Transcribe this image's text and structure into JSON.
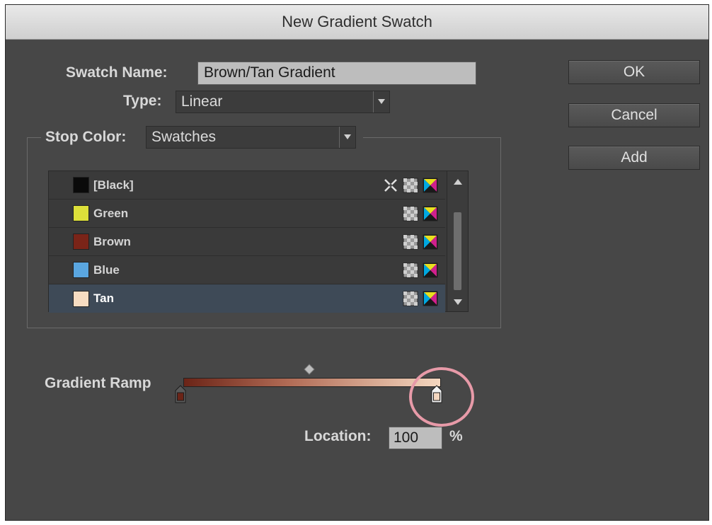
{
  "dialog": {
    "title": "New Gradient Swatch"
  },
  "form": {
    "swatch_name_label": "Swatch Name:",
    "swatch_name_value": "Brown/Tan Gradient",
    "type_label": "Type:",
    "type_value": "Linear",
    "stop_color_label": "Stop Color:",
    "stop_color_value": "Swatches"
  },
  "buttons": {
    "ok": "OK",
    "cancel": "Cancel",
    "add": "Add"
  },
  "swatches": [
    {
      "name": "[Black]",
      "color": "#0a0a0a",
      "registration_icon": true
    },
    {
      "name": "Green",
      "color": "#dde03a",
      "registration_icon": false
    },
    {
      "name": "Brown",
      "color": "#7a2418",
      "registration_icon": false
    },
    {
      "name": "Blue",
      "color": "#5aa6e0",
      "registration_icon": false
    },
    {
      "name": "Tan",
      "color": "#f6dcc1",
      "registration_icon": false,
      "selected": true
    }
  ],
  "gradient": {
    "label": "Gradient Ramp",
    "start_color": "#6b2417",
    "end_color": "#f4d7c0",
    "location_label": "Location:",
    "location_value": "100",
    "location_unit": "%"
  },
  "icons": {
    "dropdown": "chevron-down-icon",
    "registration": "crosshair-icon",
    "color_mode": "cmyk-icon",
    "spot": "checker-icon"
  }
}
